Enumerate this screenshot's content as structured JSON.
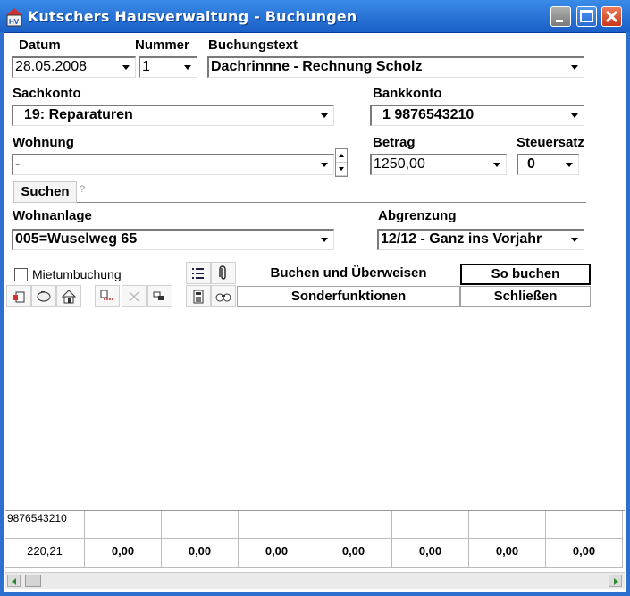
{
  "window": {
    "title": "Kutschers Hausverwaltung - Buchungen"
  },
  "labels": {
    "datum": "Datum",
    "nummer": "Nummer",
    "buchungstext": "Buchungstext",
    "sachkonto": "Sachkonto",
    "bankkonto": "Bankkonto",
    "wohnung": "Wohnung",
    "betrag": "Betrag",
    "steuersatz": "Steuersatz",
    "wohnanlage": "Wohnanlage",
    "abgrenzung": "Abgrenzung"
  },
  "fields": {
    "datum": "28.05.2008",
    "nummer": "1",
    "buchungstext": "Dachrinnne - Rechnung Scholz",
    "sachkonto": "19: Reparaturen",
    "bankkonto": "1  9876543210",
    "wohnung": "-",
    "betrag": "1250,00",
    "steuersatz": "0",
    "wohnanlage": "005=Wuselweg 65",
    "abgrenzung": "12/12 - Ganz  ins Vorjahr"
  },
  "search": {
    "button": "Suchen",
    "hint": "?"
  },
  "checkbox": {
    "label": "Mietumbuchung",
    "checked": false
  },
  "buttons": {
    "buchen_ueberweisen": "Buchen und Überweisen",
    "so_buchen": "So buchen",
    "sonderfunktionen": "Sonderfunktionen",
    "schliessen": "Schließen"
  },
  "toolbar_icons": [
    "list-icon",
    "attachment-icon",
    "new-document-icon",
    "piggy-bank-icon",
    "home-icon",
    "split-icon",
    "delete-icon",
    "transfer-icon",
    "calculator-icon",
    "binoculars-icon"
  ],
  "grid": {
    "header_first": "9876543210",
    "values": [
      "220,21",
      "0,00",
      "0,00",
      "0,00",
      "0,00",
      "0,00",
      "0,00",
      "0,00"
    ]
  },
  "colors": {
    "titlebar": "#1a5fc6",
    "window_border": "#2d6fcf"
  }
}
